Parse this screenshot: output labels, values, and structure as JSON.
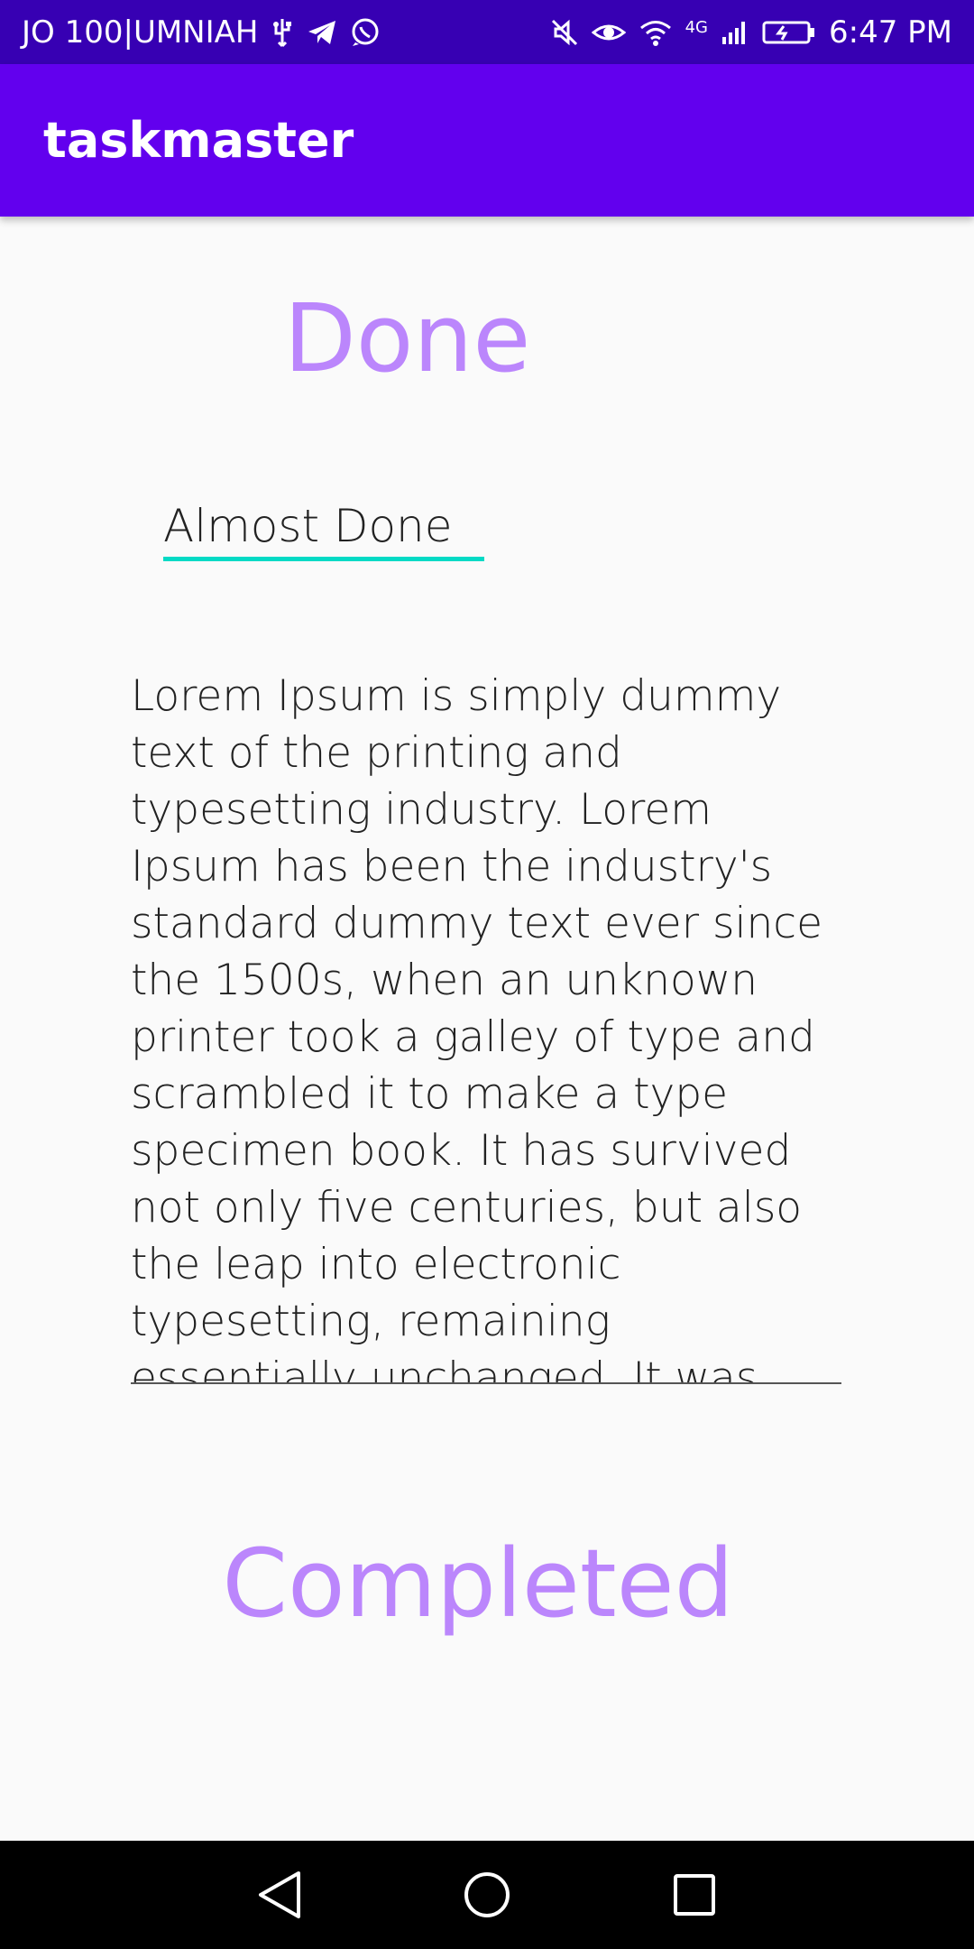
{
  "status": {
    "carrier": "JO 100|UMNIAH",
    "network": "4G",
    "time": "6:47 PM",
    "icons_left": [
      "usb-icon",
      "telegram-icon",
      "whatsapp-icon"
    ],
    "icons_right": [
      "mute-icon",
      "eye-icon",
      "wifi-icon",
      "signal-icon",
      "battery-icon"
    ]
  },
  "appbar": {
    "title": "taskmaster"
  },
  "task": {
    "title": "Done",
    "state_value": "Almost Done",
    "description": "Lorem Ipsum is simply dummy text of the printing and typesetting industry. Lorem Ipsum has been the industry's standard dummy text ever since the 1500s, when an unknown printer took a galley of type and scrambled it to make a type specimen book. It has survived not only five centuries, but also the leap into electronic typesetting, remaining essentially unchanged. It was popularised in",
    "footer_title": "Completed"
  },
  "navbar": {
    "buttons": [
      "back-icon",
      "home-icon",
      "recents-icon"
    ]
  },
  "colors": {
    "status_bar": "#3700b3",
    "app_bar": "#6200ee",
    "accent_text": "#bb86fc",
    "underline": "#03dac5"
  }
}
